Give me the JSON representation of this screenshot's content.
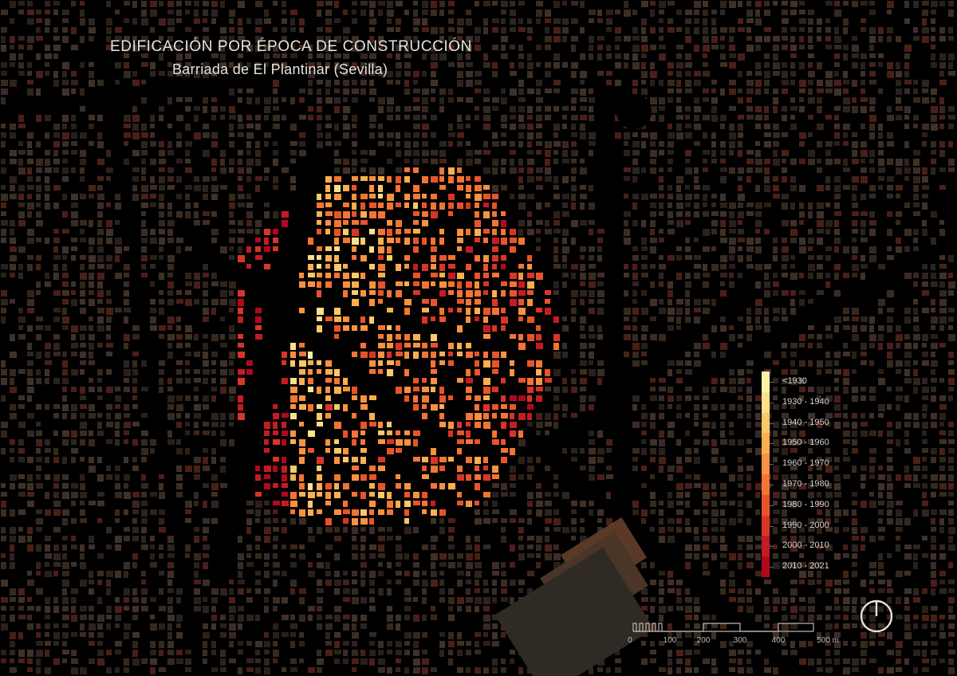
{
  "header": {
    "title": "EDIFICACIÓN POR ÉPOCA DE CONSTRUCCIÓN",
    "subtitle": "Barriada de El Plantinar (Sevilla)"
  },
  "legend": {
    "items": [
      {
        "label": "<1930",
        "color": "#fff2a8"
      },
      {
        "label": "1930 - 1940",
        "color": "#fde08a"
      },
      {
        "label": "1940 - 1950",
        "color": "#fcc96a"
      },
      {
        "label": "1950 - 1960",
        "color": "#fbb050"
      },
      {
        "label": "1960 - 1970",
        "color": "#f99240"
      },
      {
        "label": "1970 - 1980",
        "color": "#f47432"
      },
      {
        "label": "1980 - 1990",
        "color": "#e8542a"
      },
      {
        "label": "1990 - 2000",
        "color": "#d93526"
      },
      {
        "label": "2000 - 2010",
        "color": "#c51b24"
      },
      {
        "label": "2010 - 2021",
        "color": "#b0081f"
      }
    ]
  },
  "scale": {
    "labels": [
      "0",
      "100",
      "200",
      "300",
      "400",
      "500 m"
    ]
  },
  "colors": {
    "background": "#000000",
    "context_building_dark": "#2e241e",
    "context_building_mid": "#3a2d25",
    "context_building_red": "#4a1f18"
  },
  "icons": {
    "north_arrow": "north-arrow-icon"
  }
}
